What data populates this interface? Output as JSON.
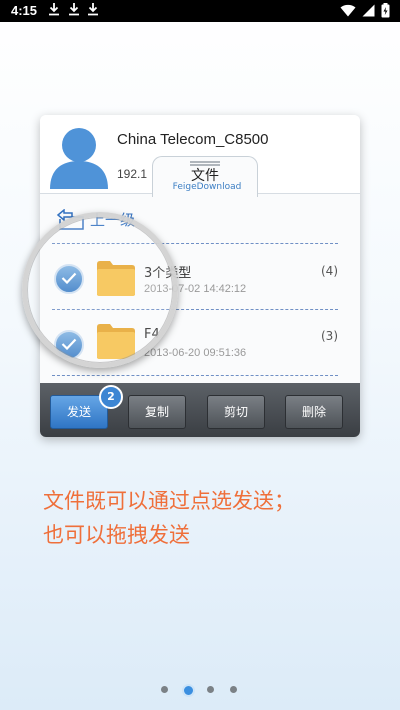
{
  "status_bar": {
    "time": "4:15",
    "icons": [
      "download-icon",
      "download-icon",
      "download-icon",
      "wifi-icon",
      "signal-icon",
      "battery-icon"
    ]
  },
  "device": {
    "name": "China Telecom_C8500",
    "ip": "192.1"
  },
  "tab": {
    "title": "文件",
    "subtitle": "FeigeDownload"
  },
  "navigation": {
    "up_label": "上一级"
  },
  "files": [
    {
      "name": "3个类型",
      "date": "2013-07-02 14:42:12",
      "count": "(4)",
      "checked": true
    },
    {
      "name": "F4",
      "date": "2013-06-20 09:51:36",
      "count": "(3)",
      "checked": true
    }
  ],
  "toolbar": {
    "send_label": "发送",
    "send_badge": "2",
    "copy_label": "复制",
    "cut_label": "剪切",
    "delete_label": "删除"
  },
  "caption": {
    "line1": "文件既可以通过点选发送；",
    "line2": "也可以拖拽发送"
  },
  "pager": {
    "count": 4,
    "active_index": 1
  },
  "colors": {
    "accent": "#3b8fe0",
    "caption": "#ef6f3a",
    "folder": "#f4b83a"
  }
}
